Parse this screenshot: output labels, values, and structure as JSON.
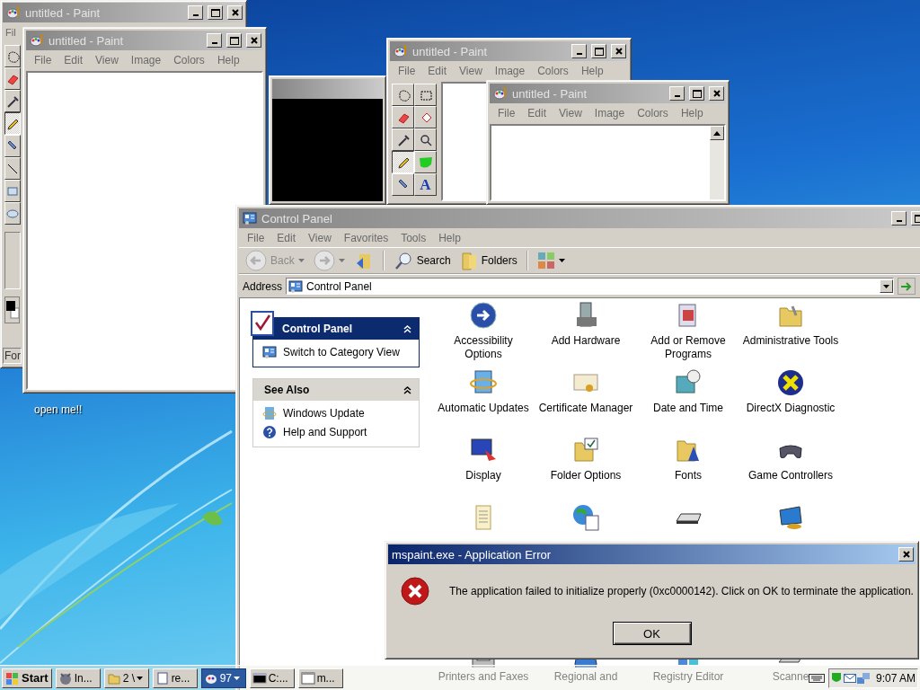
{
  "desktop": {
    "icons": [
      {
        "label": "open me!!"
      }
    ]
  },
  "windows": [
    {
      "kind": "paint",
      "title": "untitled - Paint",
      "active": false,
      "menu": [
        "Fil"
      ],
      "tools": [
        {
          "selected": false
        },
        {
          "selected": false
        },
        {
          "selected": false
        },
        {
          "selected": true
        },
        {
          "selected": false
        },
        {
          "selected": false
        },
        {
          "selected": false
        },
        {
          "selected": false
        }
      ],
      "status": "For"
    },
    {
      "kind": "paint",
      "title": "untitled - Paint",
      "active": false,
      "menu": [
        "File",
        "Edit",
        "View",
        "Image",
        "Colors",
        "Help"
      ]
    },
    {
      "kind": "console",
      "active": false
    },
    {
      "kind": "paint",
      "title": "untitled - Paint",
      "active": false,
      "menu": [
        "File",
        "Edit",
        "View",
        "Image",
        "Colors",
        "Help"
      ],
      "tools": [
        {
          "selected": false
        },
        {
          "selected": false
        },
        {
          "selected": false
        },
        {
          "selected": false
        },
        {
          "selected": false
        },
        {
          "selected": false
        },
        {
          "selected": true
        },
        {
          "selected": false
        },
        {
          "selected": false
        },
        {
          "selected": false,
          "glyph": "A"
        }
      ]
    },
    {
      "kind": "paint",
      "title": "untitled - Paint",
      "active": false,
      "menu": [
        "File",
        "Edit",
        "View",
        "Image",
        "Colors",
        "Help"
      ]
    },
    {
      "kind": "explorer",
      "title": "Control Panel",
      "active": false,
      "menu": [
        "File",
        "Edit",
        "View",
        "Favorites",
        "Tools",
        "Help"
      ],
      "toolbar": {
        "back_label": "Back",
        "nav_disabled": true,
        "search_label": "Search",
        "folders_label": "Folders"
      },
      "address": {
        "label": "Address",
        "value": "Control Panel"
      },
      "task_panes": [
        {
          "title": "Control Panel",
          "kind": "primary",
          "expanded": true,
          "links": [
            "Switch to Category View"
          ]
        },
        {
          "title": "See Also",
          "kind": "secondary",
          "expanded": true,
          "links": [
            "Windows Update",
            "Help and Support"
          ]
        }
      ],
      "items": [
        {
          "kind": "labeled",
          "label": "Accessibility Options"
        },
        {
          "kind": "labeled",
          "label": "Add Hardware"
        },
        {
          "kind": "labeled",
          "label": "Add or Remove Programs"
        },
        {
          "kind": "labeled",
          "label": "Administrative Tools"
        },
        {
          "kind": "labeled",
          "label": "Automatic Updates"
        },
        {
          "kind": "labeled",
          "label": "Certificate Manager"
        },
        {
          "kind": "labeled",
          "label": "Date and Time"
        },
        {
          "kind": "labeled",
          "label": "DirectX Diagnostic"
        },
        {
          "kind": "labeled",
          "label": "Display"
        },
        {
          "kind": "labeled",
          "label": "Folder Options"
        },
        {
          "kind": "labeled",
          "label": "Fonts"
        },
        {
          "kind": "labeled",
          "label": "Game Controllers"
        },
        {
          "kind": "icon_only"
        },
        {
          "kind": "icon_only"
        },
        {
          "kind": "icon_only"
        },
        {
          "kind": "icon_only"
        }
      ],
      "lower_items": [
        {
          "label": "Printers and Faxes"
        },
        {
          "label": "Regional and"
        },
        {
          "label": "Registry Editor"
        },
        {
          "label": "Scanne"
        }
      ]
    },
    {
      "kind": "dialog",
      "title": "mspaint.exe - Application Error",
      "active": true,
      "message": "The application failed to initialize properly (0xc0000142). Click on OK to terminate the application.",
      "button": "OK"
    }
  ],
  "taskbar": {
    "start": "Start",
    "tasks": [
      {
        "label": "In...",
        "grouped": false,
        "selected": false
      },
      {
        "label": "2 \\",
        "grouped": true,
        "selected": false
      },
      {
        "label": "re...",
        "grouped": false,
        "selected": false
      },
      {
        "label": "97",
        "grouped": true,
        "selected": true
      },
      {
        "label": "C:...",
        "grouped": false,
        "selected": false
      },
      {
        "label": "m...",
        "grouped": false,
        "selected": false
      }
    ],
    "clock": "9:07 AM"
  }
}
